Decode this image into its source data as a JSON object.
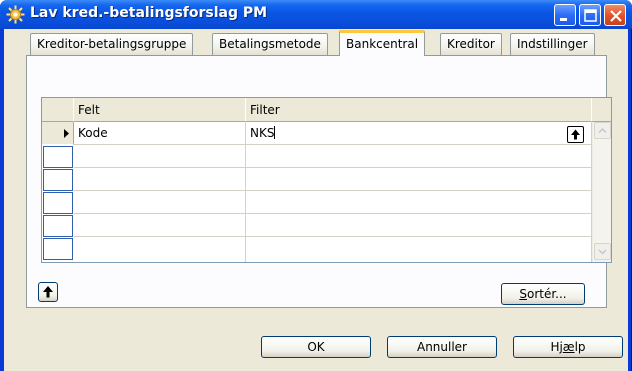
{
  "window": {
    "title": "Lav kred.-betalingsforslag PM",
    "controls": [
      "minimize-icon",
      "maximize-icon",
      "close-icon"
    ]
  },
  "tabs": [
    {
      "label": "Kreditor-betalingsgruppe",
      "active": false
    },
    {
      "label": "Betalingsmetode",
      "active": false
    },
    {
      "label": "Bankcentral",
      "active": true
    },
    {
      "label": "Kreditor",
      "active": false
    },
    {
      "label": "Indstillinger",
      "active": false
    }
  ],
  "grid": {
    "columns": [
      "Felt",
      "Filter"
    ],
    "rows": [
      {
        "felt": "Kode",
        "filter": "NKS",
        "current": true
      },
      {
        "felt": "",
        "filter": ""
      },
      {
        "felt": "",
        "filter": ""
      },
      {
        "felt": "",
        "filter": ""
      },
      {
        "felt": "",
        "filter": ""
      },
      {
        "felt": "",
        "filter": ""
      }
    ]
  },
  "buttons": {
    "sort_prefix": "S",
    "sort_rest": "ortér...",
    "ok": "OK",
    "cancel": "Annuller",
    "help_prefix": "Hj",
    "help_underline": "æ",
    "help_rest": "lp"
  },
  "icons": {
    "app": "sun-gear-icon",
    "lookup": "up-arrow-icon",
    "expand": "up-arrow-icon"
  }
}
